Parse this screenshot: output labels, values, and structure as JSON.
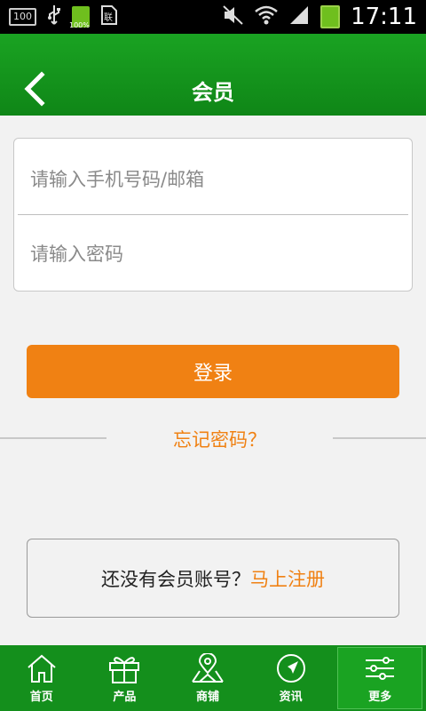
{
  "status_bar": {
    "left_box": "100",
    "battery_small_label": "100%",
    "time": "17:11"
  },
  "header": {
    "title": "会员"
  },
  "form": {
    "phone_placeholder": "请输入手机号码/邮箱",
    "password_placeholder": "请输入密码"
  },
  "login_label": "登录",
  "forgot_label": "忘记密码？",
  "register": {
    "prompt": "还没有会员账号？",
    "link": "马上注册"
  },
  "nav": {
    "items": [
      {
        "label": "首页",
        "icon": "home-icon"
      },
      {
        "label": "产品",
        "icon": "gift-icon"
      },
      {
        "label": "商铺",
        "icon": "map-pin-icon"
      },
      {
        "label": "资讯",
        "icon": "compass-icon"
      },
      {
        "label": "更多",
        "icon": "settings-sliders-icon"
      }
    ],
    "active_index": 4
  },
  "colors": {
    "header_green": "#148f1c",
    "accent_orange": "#f08113",
    "background": "#f2f2f2"
  }
}
